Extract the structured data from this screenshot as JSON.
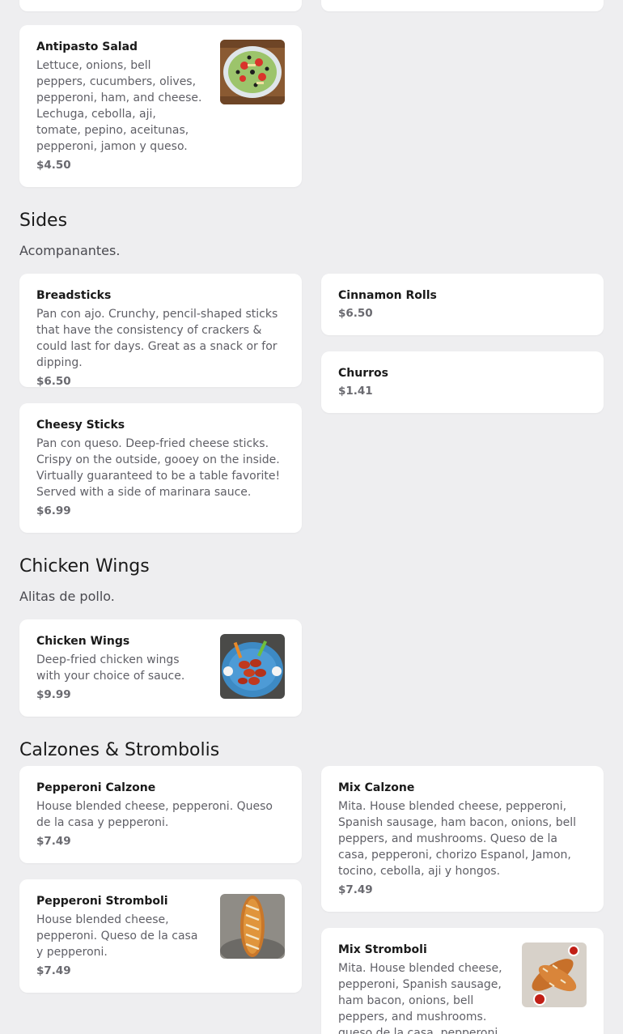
{
  "sections": {
    "salads": {
      "items": [
        {
          "name": "Antipasto Salad",
          "desc": "Lettuce, onions, bell peppers, cucumbers, olives, pepperoni, ham, and cheese. Lechuga, cebolla, aji, tomate, pepino, aceitunas, pepperoni, jamon y queso.",
          "price": "$4.50",
          "image": "antipasto-salad-photo"
        }
      ]
    },
    "sides": {
      "title": "Sides",
      "subtitle": "Acompanantes.",
      "items": [
        {
          "name": "Breadsticks",
          "desc": "Pan con ajo. Crunchy, pencil-shaped sticks that have the consistency of crackers & could last for days. Great as a snack or for dipping.",
          "price": "$6.50"
        },
        {
          "name": "Cinnamon Rolls",
          "price": "$6.50"
        },
        {
          "name": "Churros",
          "price": "$1.41"
        },
        {
          "name": "Cheesy Sticks",
          "desc": "Pan con queso. Deep-fried cheese sticks. Crispy on the outside, gooey on the inside. Virtually guaranteed to be a table favorite! Served with a side of marinara sauce.",
          "price": "$6.99"
        }
      ]
    },
    "wings": {
      "title": "Chicken Wings",
      "subtitle": "Alitas de pollo.",
      "items": [
        {
          "name": "Chicken Wings",
          "desc": "Deep-fried chicken wings with your choice of sauce.",
          "price": "$9.99",
          "image": "chicken-wings-photo"
        }
      ]
    },
    "calzones": {
      "title": "Calzones & Strombolis",
      "items": [
        {
          "name": "Pepperoni Calzone",
          "desc": "House blended cheese, pepperoni. Queso de la casa y pepperoni.",
          "price": "$7.49"
        },
        {
          "name": "Mix Calzone",
          "desc": "Mita. House blended cheese, pepperoni, Spanish sausage, ham bacon, onions, bell peppers, and mushrooms. Queso de la casa, pepperoni, chorizo Espanol, Jamon, tocino, cebolla, aji y hongos.",
          "price": "$7.49"
        },
        {
          "name": "Pepperoni Stromboli",
          "desc": "House blended cheese, pepperoni. Queso de la casa y pepperoni.",
          "price": "$7.49",
          "image": "stromboli-photo"
        },
        {
          "name": "Mix Stromboli",
          "desc": "Mita. House blended cheese, pepperoni, Spanish sausage, ham bacon, onions, bell peppers, and mushrooms. queso de la casa, pepperoni,",
          "image": "mix-stromboli-photo"
        }
      ]
    }
  },
  "colors": {
    "background": "#eeeef0",
    "card": "#ffffff",
    "title": "#1a1a1a",
    "description": "#5f5f66",
    "price": "#6a6a70"
  }
}
